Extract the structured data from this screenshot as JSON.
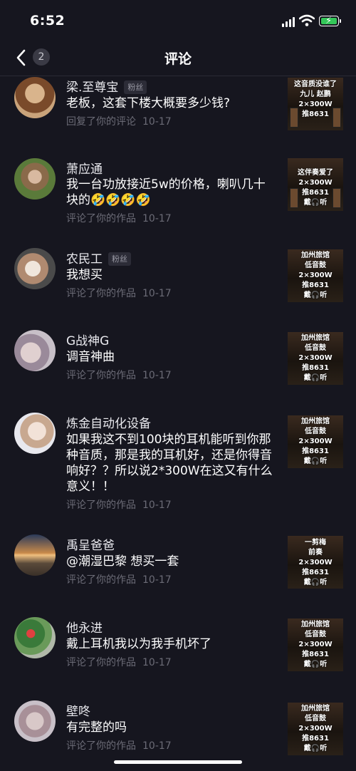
{
  "status_bar": {
    "time": "6:52"
  },
  "nav": {
    "count": "2",
    "title": "评论"
  },
  "comments": [
    {
      "name": "梁.至尊宝",
      "badge": "粉丝",
      "text": "老板，这套下楼大概要多少钱?",
      "meta": "回复了你的评论",
      "date": "10-17",
      "thumb": [
        "这音质没谁了",
        "九儿 赵鹏",
        "2×300W",
        "推8631"
      ]
    },
    {
      "name": "萧应通",
      "badge": "",
      "text": "我一台功放接近5w的价格，喇叭几十块的🤣🤣🤣🤣",
      "meta": "评论了你的作品",
      "date": "10-17",
      "thumb": [
        "这伴奏爱了",
        "2×300W",
        "推8631",
        "戴🎧听"
      ]
    },
    {
      "name": "农民工",
      "badge": "粉丝",
      "text": "我想买",
      "meta": "评论了你的作品",
      "date": "10-17",
      "thumb": [
        "加州旅馆",
        "低音鼓",
        "2×300W",
        "推8631",
        "戴🎧听"
      ]
    },
    {
      "name": "G战神G",
      "badge": "",
      "text": "调音神曲",
      "meta": "评论了你的作品",
      "date": "10-17",
      "thumb": [
        "加州旅馆",
        "低音鼓",
        "2×300W",
        "推8631",
        "戴🎧听"
      ]
    },
    {
      "name": "炼金自动化设备",
      "badge": "",
      "text": "如果我这不到100块的耳机能听到你那种音质，那是我的耳机好，还是你得音响好？？所以说2*300W在这又有什么意义！！",
      "meta": "评论了你的作品",
      "date": "10-17",
      "thumb": [
        "加州旅馆",
        "低音鼓",
        "2×300W",
        "推8631",
        "戴🎧听"
      ]
    },
    {
      "name": "禹呈爸爸",
      "badge": "",
      "text": "@潮湿巴黎 想买一套",
      "meta": "评论了你的作品",
      "date": "10-17",
      "thumb": [
        "一剪梅",
        "前奏",
        "2×300W",
        "推8631",
        "戴🎧听"
      ]
    },
    {
      "name": "他永进",
      "badge": "",
      "text": "戴上耳机我以为我手机坏了",
      "meta": "评论了你的作品",
      "date": "10-17",
      "thumb": [
        "加州旅馆",
        "低音鼓",
        "2×300W",
        "推8631",
        "戴🎧听"
      ]
    },
    {
      "name": "壁咚",
      "badge": "",
      "text": "有完整的吗",
      "meta": "评论了你的作品",
      "date": "10-17",
      "thumb": [
        "加州旅馆",
        "低音鼓",
        "2×300W",
        "推8631",
        "戴🎧听"
      ]
    }
  ]
}
